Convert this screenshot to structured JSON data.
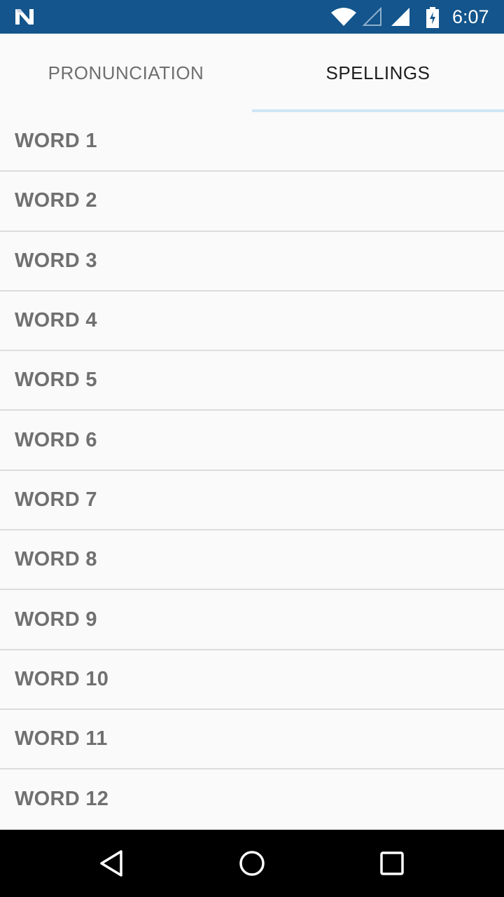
{
  "status_bar": {
    "time": "6:07",
    "icons": [
      "n-logo-icon",
      "wifi-icon",
      "cell-signal-empty-icon",
      "cell-signal-full-icon",
      "battery-charging-icon"
    ],
    "background_color": "#13558c"
  },
  "tabs": [
    {
      "label": "PRONUNCIATION",
      "active": false
    },
    {
      "label": "SPELLINGS",
      "active": true
    }
  ],
  "tab_indicator_color": "#cfe6f5",
  "words": [
    "WORD 1",
    "WORD 2",
    "WORD 3",
    "WORD 4",
    "WORD 5",
    "WORD 6",
    "WORD 7",
    "WORD 8",
    "WORD 9",
    "WORD 10",
    "WORD 11",
    "WORD 12"
  ],
  "nav_bar": {
    "icons": [
      "back-icon",
      "home-icon",
      "recents-icon"
    ]
  }
}
